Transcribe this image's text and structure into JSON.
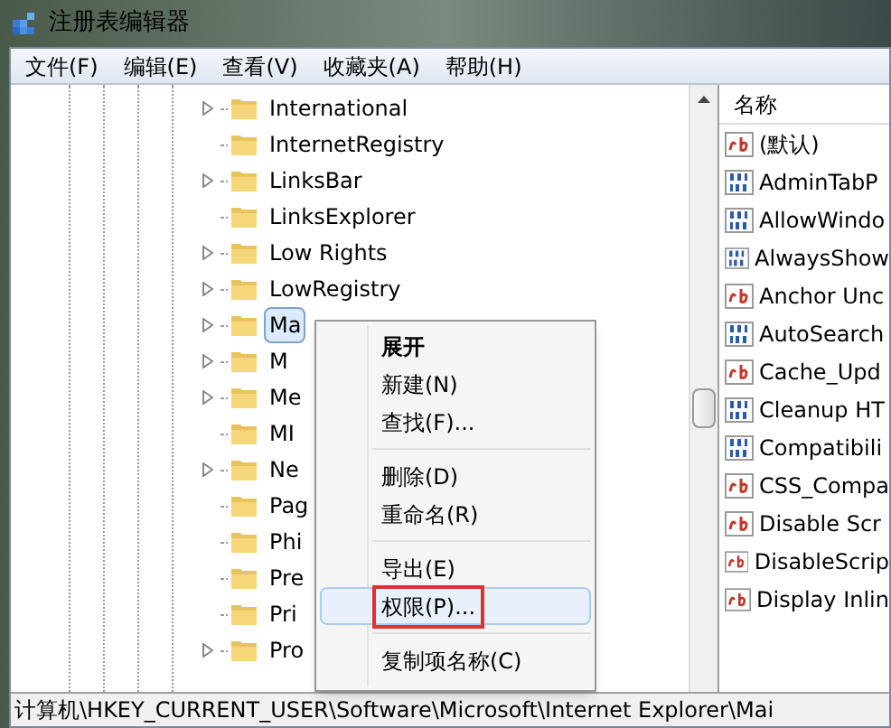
{
  "window": {
    "title": "注册表编辑器"
  },
  "menu_bar": [
    "文件(F)",
    "编辑(E)",
    "查看(V)",
    "收藏夹(A)",
    "帮助(H)"
  ],
  "tree": {
    "items": [
      {
        "label": "International",
        "has_children": true,
        "selected": false
      },
      {
        "label": "InternetRegistry",
        "has_children": false,
        "selected": false
      },
      {
        "label": "LinksBar",
        "has_children": true,
        "selected": false
      },
      {
        "label": "LinksExplorer",
        "has_children": false,
        "selected": false
      },
      {
        "label": "Low Rights",
        "has_children": true,
        "selected": false
      },
      {
        "label": "LowRegistry",
        "has_children": true,
        "selected": false
      },
      {
        "label": "Ma",
        "has_children": true,
        "selected": true
      },
      {
        "label": "M",
        "has_children": true,
        "selected": false
      },
      {
        "label": "Me",
        "has_children": true,
        "selected": false
      },
      {
        "label": "MI",
        "has_children": false,
        "selected": false
      },
      {
        "label": "Ne",
        "has_children": true,
        "selected": false
      },
      {
        "label": "Pag",
        "has_children": false,
        "selected": false
      },
      {
        "label": "Phi",
        "has_children": false,
        "selected": false
      },
      {
        "label": "Pre",
        "has_children": false,
        "selected": false
      },
      {
        "label": "Pri",
        "has_children": false,
        "selected": false
      },
      {
        "label": "Pro",
        "has_children": true,
        "selected": false
      }
    ]
  },
  "context_menu": [
    {
      "kind": "item",
      "label": "展开",
      "bold": true,
      "highlighted": false,
      "marked": false
    },
    {
      "kind": "item",
      "label": "新建(N)",
      "bold": false,
      "highlighted": false,
      "marked": false
    },
    {
      "kind": "item",
      "label": "查找(F)...",
      "bold": false,
      "highlighted": false,
      "marked": false
    },
    {
      "kind": "separator"
    },
    {
      "kind": "item",
      "label": "删除(D)",
      "bold": false,
      "highlighted": false,
      "marked": false
    },
    {
      "kind": "item",
      "label": "重命名(R)",
      "bold": false,
      "highlighted": false,
      "marked": false
    },
    {
      "kind": "separator"
    },
    {
      "kind": "item",
      "label": "导出(E)",
      "bold": false,
      "highlighted": false,
      "marked": false
    },
    {
      "kind": "item",
      "label": "权限(P)...",
      "bold": false,
      "highlighted": true,
      "marked": true
    },
    {
      "kind": "separator"
    },
    {
      "kind": "item",
      "label": "复制项名称(C)",
      "bold": false,
      "highlighted": false,
      "marked": false
    }
  ],
  "values_pane": {
    "column": "名称",
    "rows": [
      {
        "kind": "string",
        "name": "(默认)"
      },
      {
        "kind": "binary",
        "name": "AdminTabP"
      },
      {
        "kind": "binary",
        "name": "AllowWindo"
      },
      {
        "kind": "binary",
        "name": "AlwaysShow"
      },
      {
        "kind": "string",
        "name": "Anchor Unc"
      },
      {
        "kind": "binary",
        "name": "AutoSearch"
      },
      {
        "kind": "string",
        "name": "Cache_Upd"
      },
      {
        "kind": "binary",
        "name": "Cleanup HT"
      },
      {
        "kind": "binary",
        "name": "Compatibili"
      },
      {
        "kind": "string",
        "name": "CSS_Compa"
      },
      {
        "kind": "string",
        "name": "Disable Scr"
      },
      {
        "kind": "string",
        "name": "DisableScrip"
      },
      {
        "kind": "string",
        "name": "Display Inlin"
      }
    ]
  },
  "status_bar": "计算机\\HKEY_CURRENT_USER\\Software\\Microsoft\\Internet Explorer\\Mai"
}
